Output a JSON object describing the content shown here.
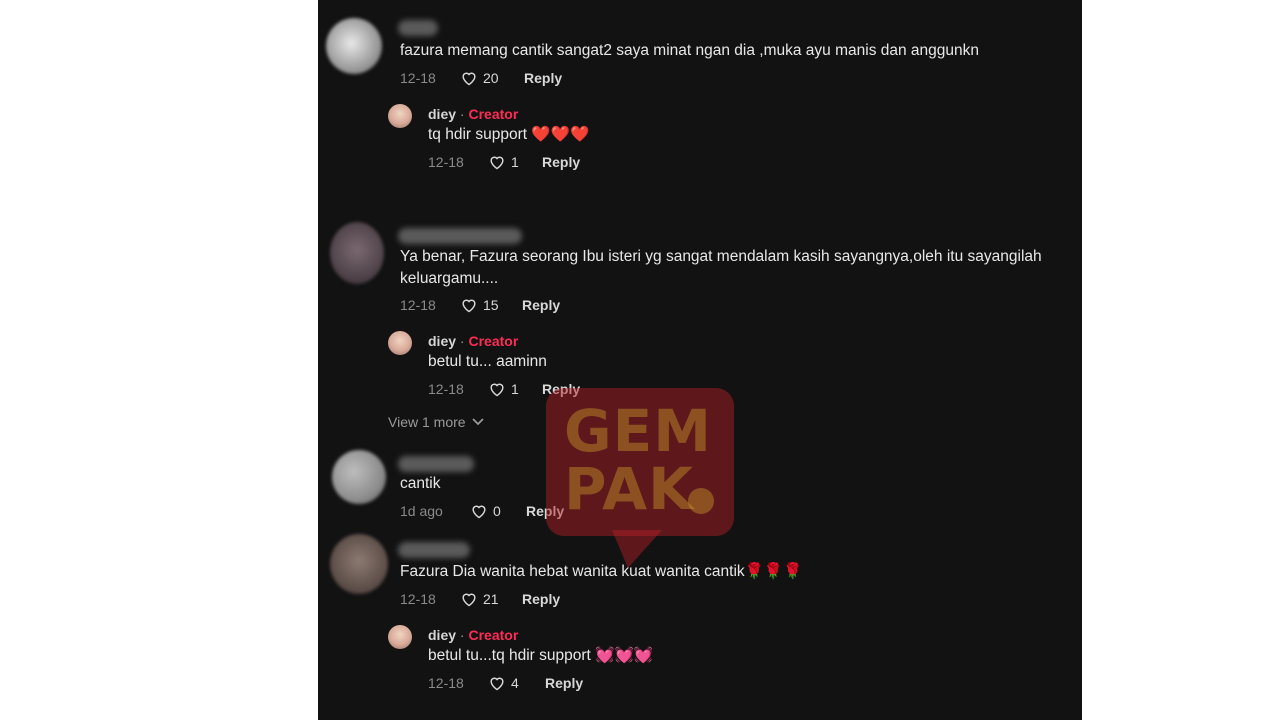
{
  "comments": [
    {
      "text": "fazura memang cantik sangat2 saya minat ngan dia ,muka ayu manis dan anggunkn",
      "date": "12-18",
      "likes": "20",
      "reply": "Reply",
      "replies": [
        {
          "author": "diey",
          "sep": " · ",
          "badge": "Creator",
          "text": "tq hdir support ❤️❤️❤️",
          "date": "12-18",
          "likes": "1",
          "reply": "Reply"
        }
      ]
    },
    {
      "text": "Ya benar, Fazura seorang Ibu isteri yg sangat mendalam kasih sayangnya,oleh itu sayangilah keluargamu....",
      "date": "12-18",
      "likes": "15",
      "reply": "Reply",
      "replies": [
        {
          "author": "diey",
          "sep": " · ",
          "badge": "Creator",
          "text": "betul tu... aaminn",
          "date": "12-18",
          "likes": "1",
          "reply": "Reply"
        }
      ],
      "view_more": "View 1 more"
    },
    {
      "text": "cantik",
      "date": "1d ago",
      "likes": "0",
      "reply": "Reply"
    },
    {
      "text": "Fazura Dia wanita hebat wanita kuat wanita cantik🌹🌹🌹",
      "date": "12-18",
      "likes": "21",
      "reply": "Reply",
      "replies": [
        {
          "author": "diey",
          "sep": " · ",
          "badge": "Creator",
          "text": "betul tu...tq hdir support 💓💓💓",
          "date": "12-18",
          "likes": "4",
          "reply": "Reply"
        }
      ]
    }
  ],
  "watermark": {
    "line1": "GEM",
    "line2": "PAK"
  },
  "icons": {
    "like": "heart-outline-icon",
    "chevron": "chevron-down-icon"
  },
  "colors": {
    "background": "#121212",
    "creator": "#fe2c55",
    "text": "#e8e8e8",
    "muted": "#8a8a8a"
  }
}
